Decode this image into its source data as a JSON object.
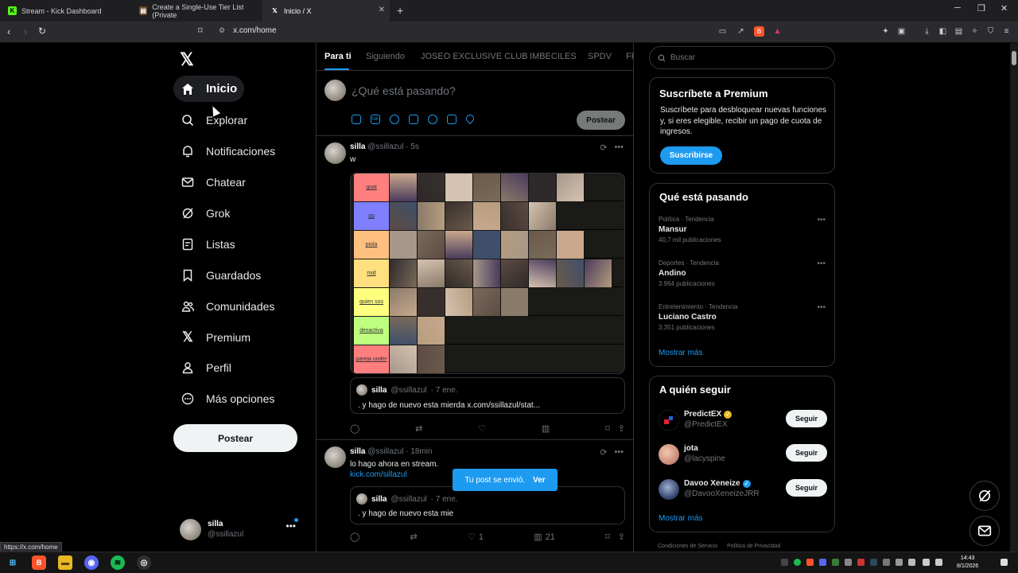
{
  "browser": {
    "tabs": [
      {
        "title": "Stream - Kick Dashboard",
        "favicon": "kick-icon"
      },
      {
        "title": "Create a Single-Use Tier List (Private",
        "favicon": "tiermaker-icon"
      },
      {
        "title": "Inicio / X",
        "favicon": "x-icon",
        "active": true
      }
    ],
    "url": "x.com/home",
    "status_url": "https://x.com/home"
  },
  "sidebar": {
    "items": [
      {
        "label": "Inicio",
        "icon": "home-icon",
        "active": true
      },
      {
        "label": "Explorar",
        "icon": "search-icon"
      },
      {
        "label": "Notificaciones",
        "icon": "bell-icon"
      },
      {
        "label": "Chatear",
        "icon": "mail-icon"
      },
      {
        "label": "Grok",
        "icon": "grok-icon"
      },
      {
        "label": "Listas",
        "icon": "list-icon"
      },
      {
        "label": "Guardados",
        "icon": "bookmark-icon"
      },
      {
        "label": "Comunidades",
        "icon": "people-icon"
      },
      {
        "label": "Premium",
        "icon": "x-icon"
      },
      {
        "label": "Perfil",
        "icon": "person-icon"
      },
      {
        "label": "Más opciones",
        "icon": "more-icon"
      }
    ],
    "post_label": "Postear",
    "account": {
      "name": "silla",
      "handle": "@ssillazul"
    }
  },
  "feed": {
    "tabs": [
      "Para ti",
      "Siguiendo",
      "JOSEO EXCLUSIVE CLUB",
      "IMBECILES",
      "SPDV",
      "FR"
    ],
    "composer": {
      "placeholder": "¿Qué está pasando?",
      "post_label": "Postear"
    },
    "tweets": [
      {
        "name": "silla",
        "handle": "@ssillazul",
        "time": "· 5s",
        "text": "w",
        "tier_labels": [
          "goat",
          "gg",
          "piola",
          "mid",
          "quien sos",
          "desactiva",
          "pareja under"
        ],
        "tier_colors": [
          "#ff7f7f",
          "#7f7fff",
          "#ffbf7f",
          "#ffdf7f",
          "#ffff7f",
          "#bfff7f",
          "#ff7f7f"
        ],
        "tier_counts": [
          7,
          6,
          7,
          8,
          5,
          2,
          2
        ],
        "quote": {
          "name": "silla",
          "handle": "@ssillazul",
          "time": "· 7 ene.",
          "text": ". y hago de nuevo esta mierda x.com/ssillazul/stat..."
        }
      },
      {
        "name": "silla",
        "handle": "@ssillazul",
        "time": "· 18min",
        "text": "lo hago ahora en stream.",
        "link": "kick.com/sillazul",
        "quote": {
          "name": "silla",
          "handle": "@ssillazul",
          "time": "· 7 ene.",
          "text": ". y hago de nuevo esta mie"
        },
        "likes": "1",
        "views": "21"
      }
    ]
  },
  "right": {
    "search_placeholder": "Buscar",
    "premium": {
      "title": "Suscríbete a Premium",
      "text": "Suscríbete para desbloquear nuevas funciones y, si eres elegible, recibir un pago de cuota de ingresos.",
      "button": "Suscribirse"
    },
    "trending": {
      "title": "Qué está pasando",
      "items": [
        {
          "context": "Política · Tendencia",
          "topic": "Mansur",
          "posts": "40,7 mil publicaciones"
        },
        {
          "context": "Deportes · Tendencia",
          "topic": "Andino",
          "posts": "3.964 publicaciones"
        },
        {
          "context": "Entretenimiento · Tendencia",
          "topic": "Luciano Castro",
          "posts": "3.351 publicaciones"
        }
      ],
      "more": "Mostrar más"
    },
    "follow": {
      "title": "A quién seguir",
      "items": [
        {
          "name": "PredictEX",
          "handle": "@PredictEX",
          "verified_color": "#e8b923"
        },
        {
          "name": "jota",
          "handle": "@lacyspine"
        },
        {
          "name": "Davoo Xeneize",
          "handle": "@DavooXeneizeJRR",
          "verified_color": "#1d9bf0"
        }
      ],
      "button": "Seguir",
      "more": "Mostrar más"
    },
    "footer": [
      "Condiciones de Servicio",
      "Política de Privacidad"
    ]
  },
  "toast": {
    "text": "Tu post se envió.",
    "action": "Ver"
  },
  "clock": {
    "time": "14:43",
    "date": "8/1/2026"
  }
}
